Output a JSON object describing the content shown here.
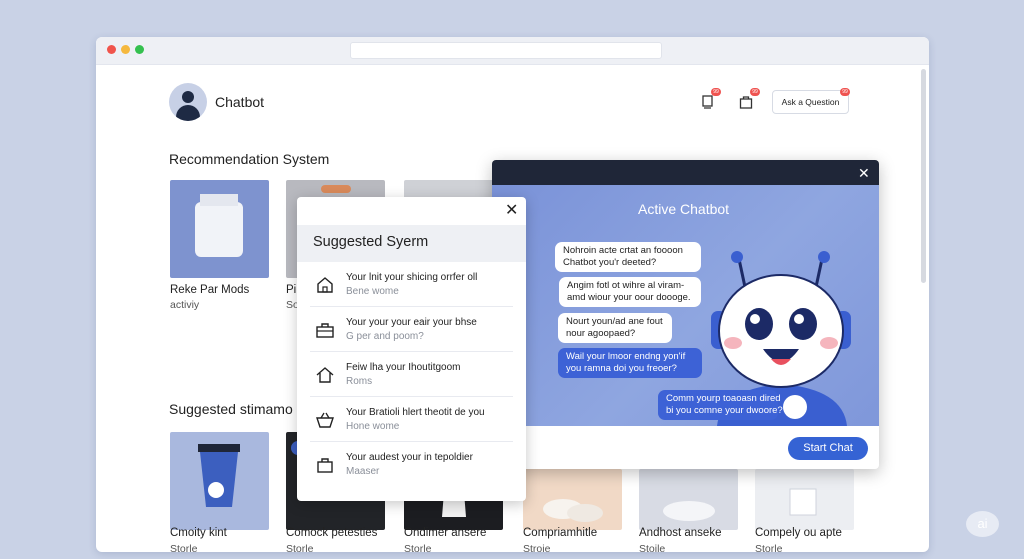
{
  "header": {
    "app_name": "Chatbot",
    "ask_button": "Ask a Question",
    "badges": [
      "99",
      "99",
      "99"
    ]
  },
  "sections": {
    "recommendation": "Recommendation System",
    "suggested": "Suggested stimamo"
  },
  "rec_cards": [
    {
      "title": "Reke Par Mods",
      "sub": "activiy"
    },
    {
      "title": "Pi",
      "sub": "So"
    }
  ],
  "sug_cards": [
    {
      "title": "Cmoity kint",
      "sub": "Storle"
    },
    {
      "title": "Comock petesties",
      "sub": "Storle"
    },
    {
      "title": "Ondimer ansere",
      "sub": "Storle"
    },
    {
      "title": "Compriamhitle",
      "sub": "Stroie"
    },
    {
      "title": "Andhost anseke",
      "sub": "Stoile"
    },
    {
      "title": "Compely ou apte",
      "sub": "Storle"
    }
  ],
  "popup": {
    "title": "Suggested Syerm",
    "close": "✕",
    "items": [
      {
        "icon": "house-icon",
        "line1": "Your lnit your shicing orrfer oll",
        "line2": "Bene wome"
      },
      {
        "icon": "briefcase-icon",
        "line1": "Your your your eair your bhse",
        "line2": "G per and poom?"
      },
      {
        "icon": "home-icon",
        "line1": "Feiw lha your Ihoutitgoom",
        "line2": "Roms"
      },
      {
        "icon": "basket-icon",
        "line1": "Your Bratioli hlert theotit de you",
        "line2": "Hone wome"
      },
      {
        "icon": "bag-icon",
        "line1": "Your audest your in tepoldier",
        "line2": "Maaser"
      }
    ]
  },
  "chat": {
    "title": "Active Chatbot",
    "close": "✕",
    "bubbles": [
      {
        "text": "Nohroin acte crtat an foooon\nChatbot you'r deeted?",
        "style": "white"
      },
      {
        "text": "Angim fotl ot wihre al viram-\namd wiour your oour doooge.",
        "style": "white"
      },
      {
        "text": "Nourt youn/ad ane fout\nnour agoopaed?",
        "style": "white"
      },
      {
        "text": "Wail your lmoor endng yon'if\nyou ramna doi you freoer?",
        "style": "blue"
      },
      {
        "text": "Comm yourp toaoasn dired\nbi you comne your dwoore?",
        "style": "blue"
      }
    ],
    "start_button": "Start Chat"
  },
  "colors": {
    "accent": "#3563d4",
    "panel_bg": "#8fa6e0",
    "topbar": "#1f2638"
  },
  "watermark": "ai"
}
